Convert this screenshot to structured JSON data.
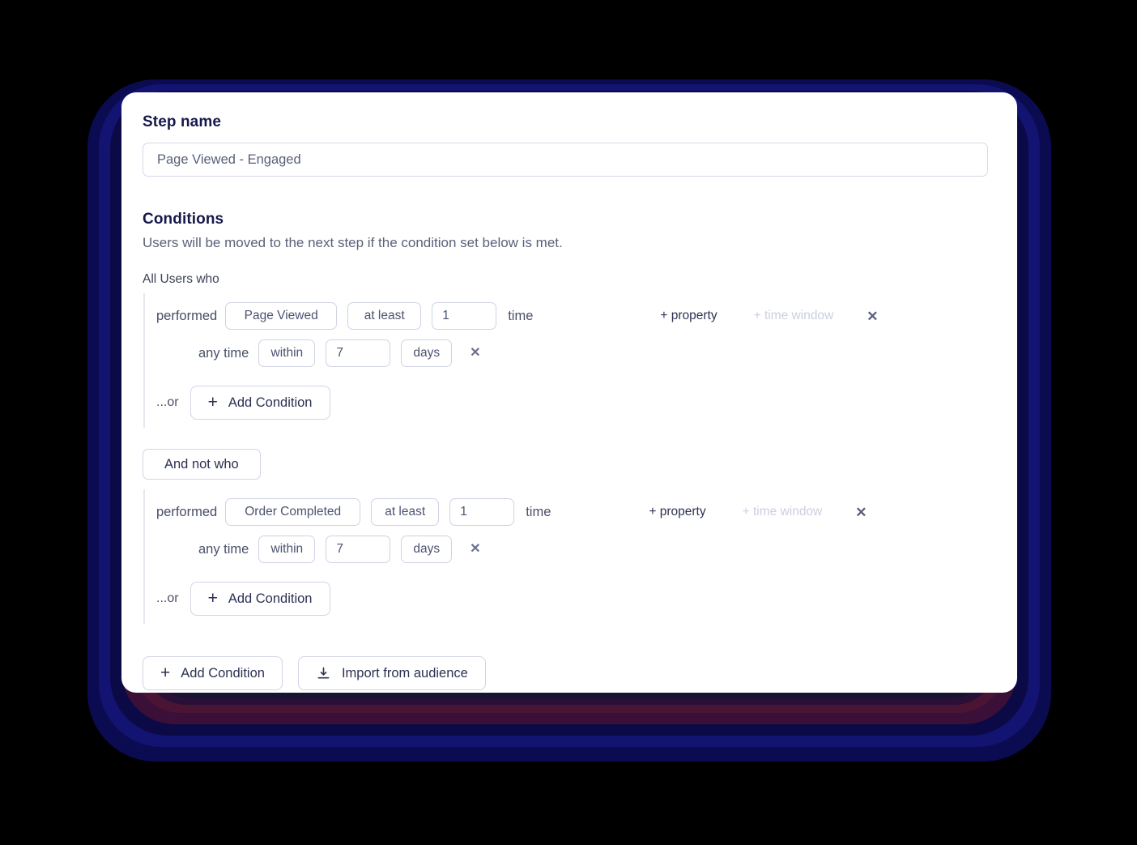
{
  "step": {
    "label": "Step name",
    "value": "Page Viewed - Engaged",
    "placeholder": "Step name"
  },
  "conditions": {
    "title": "Conditions",
    "description": "Users will be moved to the next step if the condition set below is met.",
    "groups": [
      {
        "label": "All Users who",
        "rows": [
          {
            "verb": "performed",
            "event": "Page Viewed",
            "operator": "at least",
            "count": "1",
            "count_unit": "time",
            "add_property": "+ property",
            "add_time_window": "+ time window",
            "remove": "✕",
            "time_prefix": "any time",
            "time_operator": "within",
            "time_value": "7",
            "time_unit": "days",
            "time_remove": "✕"
          }
        ],
        "or_label": "...or",
        "add_condition": "Add Condition"
      },
      {
        "label": "And not who",
        "rows": [
          {
            "verb": "performed",
            "event": "Order Completed",
            "operator": "at least",
            "count": "1",
            "count_unit": "time",
            "add_property": "+ property",
            "add_time_window": "+ time window",
            "remove": "✕",
            "time_prefix": "any time",
            "time_operator": "within",
            "time_value": "7",
            "time_unit": "days",
            "time_remove": "✕"
          }
        ],
        "or_label": "...or",
        "add_condition": "Add Condition"
      }
    ]
  },
  "footer": {
    "add_condition": "Add Condition",
    "import_audience": "Import from audience",
    "plus_glyph": "+",
    "import_icon": "download-icon"
  },
  "colors": {
    "heading": "#16184a",
    "body_text": "#5b6179",
    "border": "#cfd3e4",
    "card_bg": "#ffffff",
    "page_bg": "#000000",
    "muted_link": "#cbcfe0",
    "glow_blue": "#131371",
    "glow_purple": "#4a1535"
  }
}
